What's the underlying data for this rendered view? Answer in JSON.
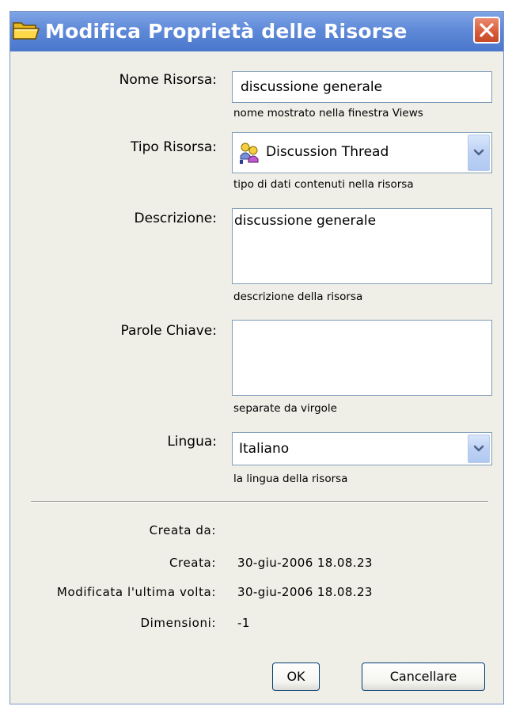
{
  "window": {
    "title": "Modifica Proprietà delle Risorse",
    "title_icon": "folder-icon",
    "close_icon": "close-icon"
  },
  "form": {
    "name": {
      "label": "Nome Risorsa:",
      "value": "discussione generale",
      "hint": "nome mostrato nella finestra Views"
    },
    "type": {
      "label": "Tipo Risorsa:",
      "value": "Discussion Thread",
      "icon": "discussion-thread-icon",
      "hint": "tipo di dati contenuti nella risorsa"
    },
    "description": {
      "label": "Descrizione:",
      "value": "discussione generale",
      "hint": "descrizione della risorsa"
    },
    "keywords": {
      "label": "Parole Chiave:",
      "value": "",
      "hint": "separate da virgole"
    },
    "language": {
      "label": "Lingua:",
      "value": "Italiano",
      "hint": "la lingua della risorsa"
    }
  },
  "info": {
    "created_by": {
      "label": "Creata da:",
      "value": ""
    },
    "created": {
      "label": "Creata:",
      "value": "30-giu-2006 18.08.23"
    },
    "modified": {
      "label": "Modificata l'ultima volta:",
      "value": "30-giu-2006 18.08.23"
    },
    "size": {
      "label": "Dimensioni:",
      "value": "-1"
    }
  },
  "buttons": {
    "ok": "OK",
    "cancel": "Cancellare"
  },
  "colors": {
    "titlebar": "#5f8ad8",
    "dialog_bg": "#efefe7",
    "close_button": "#d85a38",
    "field_border": "#7f9db9"
  }
}
